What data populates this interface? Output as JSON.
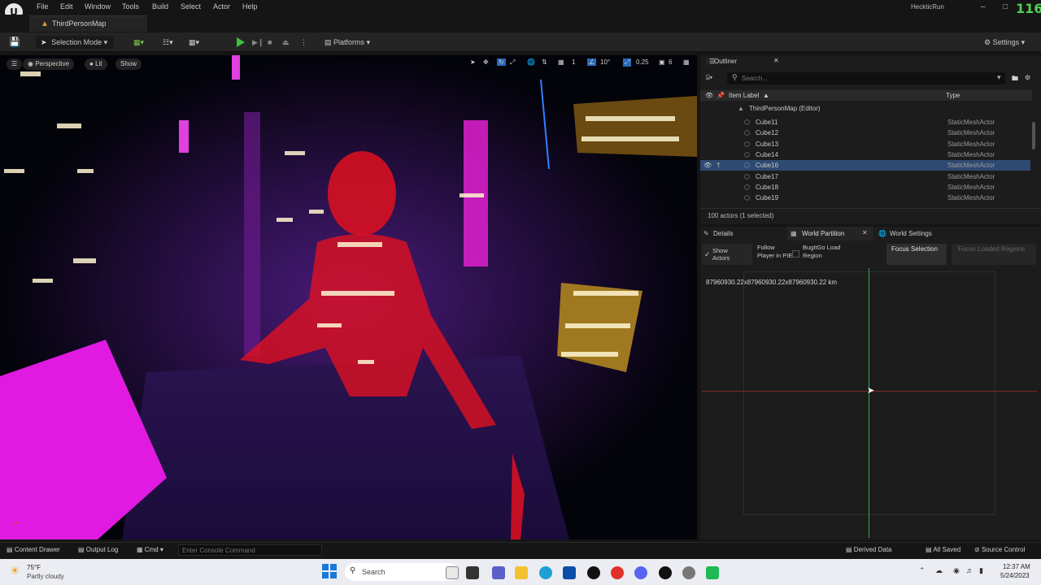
{
  "menu": [
    "File",
    "Edit",
    "Window",
    "Tools",
    "Build",
    "Select",
    "Actor",
    "Help"
  ],
  "map_tab": "ThirdPersonMap",
  "app_name": "HeckticRun",
  "fps": "116",
  "toolbar": {
    "selection_mode": "Selection Mode",
    "platforms": "Platforms",
    "settings": "Settings"
  },
  "viewport": {
    "perspective": "Perspective",
    "lit": "Lit",
    "show": "Show",
    "grid_value": "1",
    "angle_value": "10°",
    "scale_value": "0.25",
    "camera_speed": "6"
  },
  "outliner": {
    "tab": "Outliner",
    "search_placeholder": "Search...",
    "col_label": "Item Label",
    "col_type": "Type",
    "root": "ThirdPersonMap (Editor)",
    "rows": [
      {
        "label": "Cube11",
        "type": "StaticMeshActor"
      },
      {
        "label": "Cube12",
        "type": "StaticMeshActor"
      },
      {
        "label": "Cube13",
        "type": "StaticMeshActor"
      },
      {
        "label": "Cube14",
        "type": "StaticMeshActor"
      },
      {
        "label": "Cube16",
        "type": "StaticMeshActor"
      },
      {
        "label": "Cube17",
        "type": "StaticMeshActor"
      },
      {
        "label": "Cube18",
        "type": "StaticMeshActor"
      },
      {
        "label": "Cube19",
        "type": "StaticMeshActor"
      }
    ],
    "selected_index": 4,
    "count": "100 actors (1 selected)"
  },
  "details": {
    "tab_details": "Details",
    "tab_world_partition": "World Partition",
    "tab_world_settings": "World Settings",
    "show_actors": "Show Actors",
    "follow_player": "Follow Player in PIE",
    "bugitgo": "BugItGo Load Region",
    "focus_selection": "Focus Selection",
    "focus_loaded": "Focus Loaded Regions",
    "size_readout": "87960930.22x87960930.22x87960930.22 km"
  },
  "statusbar": {
    "content_drawer": "Content Drawer",
    "output_log": "Output Log",
    "cmd": "Cmd",
    "console_placeholder": "Enter Console Command",
    "derived_data": "Derived Data",
    "all_saved": "All Saved",
    "source_control": "Source Control"
  },
  "taskbar": {
    "temp": "75°F",
    "weather": "Partly cloudy",
    "search": "Search",
    "time": "12:37 AM",
    "date": "5/24/2023"
  },
  "colors": {
    "accent": "#2f4a72",
    "play": "#3fbf3f",
    "fps": "#4fd04f"
  }
}
